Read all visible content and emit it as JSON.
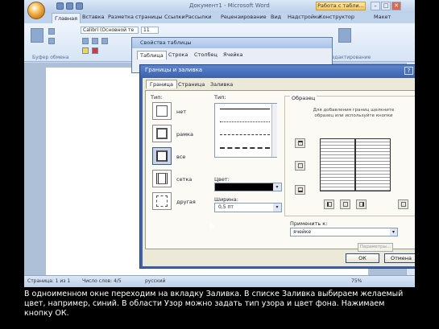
{
  "window": {
    "title": "Документ1 - Microsoft Word",
    "context_tab": "Работа с табли...",
    "min": "–",
    "max": "□",
    "close": "✕"
  },
  "tabs": [
    "Главная",
    "Вставка",
    "Разметка страницы",
    "Ссылки",
    "Рассылки",
    "Рецензирование",
    "Вид",
    "Надстройки",
    "Конструктор",
    "Макет"
  ],
  "ribbon": {
    "font_name": "Calibri (Основной те",
    "font_size": "11",
    "groups": {
      "clipboard": "Буфер обмена",
      "editing": "Редактирование"
    }
  },
  "table_properties": {
    "title": "Свойства таблицы",
    "tabs": [
      "Таблица",
      "Строка",
      "Столбец",
      "Ячейка"
    ]
  },
  "borders_dialog": {
    "title": "Границы и заливка",
    "help": "?",
    "close": "✕",
    "tabs": [
      "Граница",
      "Страница",
      "Заливка"
    ],
    "type_label": "Тип:",
    "settings": [
      {
        "label": "нет"
      },
      {
        "label": "рамка"
      },
      {
        "label": "все"
      },
      {
        "label": "сетка"
      },
      {
        "label": "другая"
      }
    ],
    "style_label": "Тип:",
    "color_label": "Цвет:",
    "width_label": "Ширина:",
    "width_value": "0,5 пт",
    "preview_label": "Образец",
    "preview_hint": "Для добавления границ щелкните образец или используйте кнопки",
    "apply_label": "Применить к:",
    "apply_value": "ячейке",
    "params": "Параметры...",
    "ok": "ОК",
    "cancel": "Отмена"
  },
  "statusbar": {
    "page": "Страница: 1 из 1",
    "words": "Число слов: 4/5",
    "lang": "русский",
    "zoom": "75%"
  },
  "subtitle": "В одноименном окне переходим на вкладку Заливка. В списке Заливка выбираем желаемый цвет, например, синий. В области Узор можно задать тип узора и цвет фона. Нажимаем кнопку ОК."
}
